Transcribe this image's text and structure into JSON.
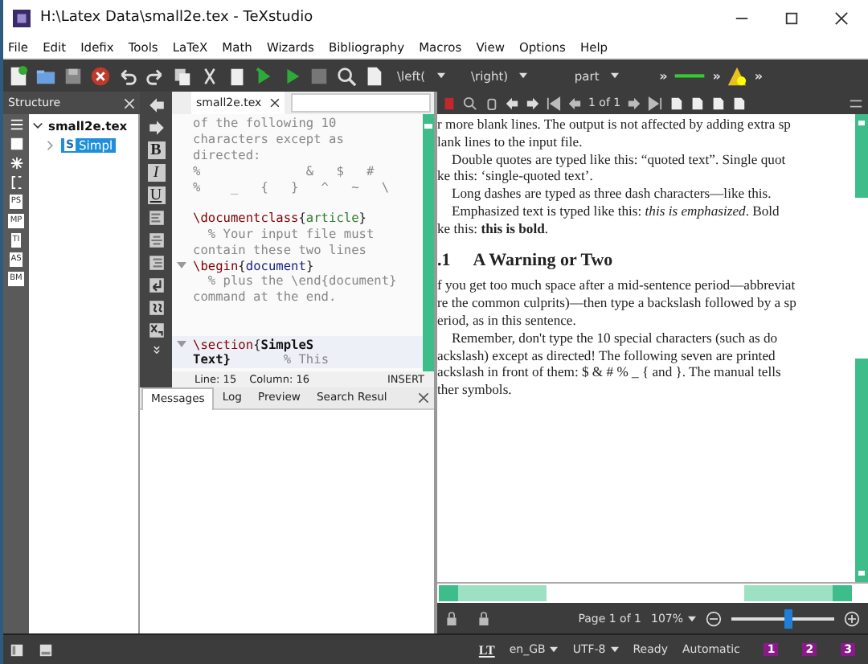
{
  "window": {
    "title": "H:\\Latex Data\\small2e.tex - TeXstudio"
  },
  "menu": [
    "File",
    "Edit",
    "Idefix",
    "Tools",
    "LaTeX",
    "Math",
    "Wizards",
    "Bibliography",
    "Macros",
    "View",
    "Options",
    "Help"
  ],
  "toolbar": {
    "combos": [
      "\\left(",
      "\\right)",
      "part"
    ],
    "overflow": [
      "»",
      "»",
      "»"
    ]
  },
  "structure": {
    "title": "Structure",
    "side_tabs": [
      "PS",
      "MP",
      "TI",
      "AS",
      "BM"
    ],
    "tree": [
      {
        "label": "small2e.tex",
        "expanded": true,
        "children": [
          {
            "label": "Simpl",
            "badge": "S",
            "expanded": false,
            "selected": true
          }
        ]
      }
    ]
  },
  "editor": {
    "format_buttons": [
      "B",
      "I",
      "U"
    ],
    "tab": "small2e.tex",
    "lines": [
      {
        "segments": [
          {
            "kind": "comment",
            "text": "of the following 10"
          }
        ]
      },
      {
        "segments": [
          {
            "kind": "comment",
            "text": "characters except as"
          }
        ]
      },
      {
        "segments": [
          {
            "kind": "comment",
            "text": "directed:"
          }
        ]
      },
      {
        "segments": [
          {
            "kind": "comment",
            "text": "%              &   $   #"
          }
        ]
      },
      {
        "segments": [
          {
            "kind": "comment",
            "text": "%    _   {   }   ^   ~   \\"
          }
        ]
      },
      {
        "blank": true
      },
      {
        "segments": [
          {
            "kind": "command",
            "text": "\\documentclass"
          },
          {
            "kind": "brace",
            "text": "{"
          },
          {
            "kind": "arg",
            "text": "article"
          },
          {
            "kind": "brace",
            "text": "}"
          }
        ]
      },
      {
        "segments": [
          {
            "kind": "comment",
            "text": "  % Your input file must"
          }
        ]
      },
      {
        "segments": [
          {
            "kind": "comment",
            "text": "contain these two lines"
          }
        ]
      },
      {
        "fold": true,
        "segments": [
          {
            "kind": "command",
            "text": "\\begin"
          },
          {
            "kind": "brace",
            "text": "{"
          },
          {
            "kind": "env",
            "text": "document"
          },
          {
            "kind": "brace",
            "text": "}"
          }
        ]
      },
      {
        "segments": [
          {
            "kind": "comment",
            "text": "  % plus the \\end{document}"
          }
        ]
      },
      {
        "segments": [
          {
            "kind": "comment",
            "text": "command at the end."
          }
        ]
      },
      {
        "blank": true
      },
      {
        "blank": true
      },
      {
        "fold": true,
        "current": true,
        "segments": [
          {
            "kind": "command",
            "text": "\\section"
          },
          {
            "kind": "brace",
            "text": "{"
          },
          {
            "kind": "title",
            "text": "SimpleS"
          }
        ]
      },
      {
        "current": true,
        "segments": [
          {
            "kind": "title",
            "text": "Text}"
          },
          {
            "kind": "comment",
            "text": "       % This"
          }
        ]
      }
    ],
    "status": {
      "line": "Line: 15",
      "column": "Column: 16",
      "mode": "INSERT"
    }
  },
  "messages": {
    "tabs": [
      {
        "label": "Messages",
        "selected": true
      },
      {
        "label": "Log",
        "selected": false
      },
      {
        "label": "Preview",
        "selected": false
      },
      {
        "label": "Search Resul",
        "selected": false
      }
    ]
  },
  "pdf": {
    "page_field": "1 of 1",
    "paragraphs": [
      {
        "kind": "text",
        "lines": [
          "r more blank lines. The output is not affected by adding extra sp",
          "lank lines to the input file."
        ]
      },
      {
        "kind": "text",
        "lines": [
          "Double quotes are typed like this: “quoted text”. Single quot",
          "ke this: ‘single-quoted text’."
        ],
        "indent": true
      },
      {
        "kind": "text",
        "lines": [
          "Long dashes are typed as three dash characters—like this."
        ],
        "indent": true
      },
      {
        "kind": "text",
        "lines": [
          "Emphasized text is typed like this: *this is emphasized*. Bold",
          "ke this: **this is bold**."
        ],
        "indent": true
      },
      {
        "kind": "heading",
        "number": ".1",
        "lines": [
          "A Warning or Two"
        ]
      },
      {
        "kind": "text",
        "lines": [
          "f you get too much space after a mid-sentence period—abbreviat",
          "re the common culprits)—then type a backslash followed by a sp",
          "eriod, as in this sentence."
        ]
      },
      {
        "kind": "text",
        "lines": [
          "Remember, don't type the 10 special characters (such as do",
          "ackslash) except as directed! The following seven are printed",
          "ackslash in front of them: $ & # % _ { and }. The manual tells",
          "ther symbols."
        ],
        "indent": true
      }
    ],
    "page_label": "Page 1 of 1",
    "zoom": "107%",
    "zoom_slider": {
      "level": 0.55
    }
  },
  "status_bar": {
    "logo": "LT",
    "language": "en_GB",
    "encoding": "UTF-8",
    "state": "Ready",
    "mode": "Automatic",
    "bookmarks": [
      "1",
      "2",
      "3"
    ]
  }
}
